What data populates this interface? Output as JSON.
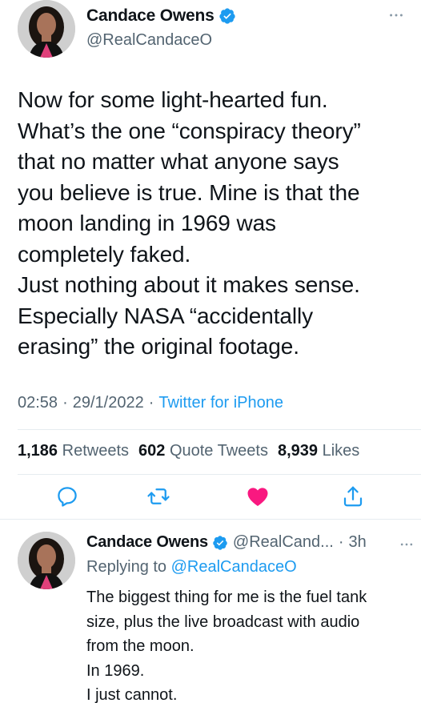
{
  "tweet": {
    "author_name": "Candace Owens",
    "author_handle": "@RealCandaceO",
    "text_lines": [
      "Now for some light-hearted fun.",
      "What’s the one “conspiracy theory”",
      "that no matter what anyone says",
      "you believe is true. Mine is that the",
      "moon landing in 1969 was",
      "completely faked.",
      "Just nothing about it makes sense.",
      "Especially NASA “accidentally",
      "erasing” the original footage."
    ],
    "time": "02:58",
    "date": "29/1/2022",
    "source": "Twitter for iPhone",
    "separator": "·"
  },
  "stats": {
    "retweets_count": "1,186",
    "retweets_label": "Retweets",
    "quotes_count": "602",
    "quotes_label": "Quote Tweets",
    "likes_count": "8,939",
    "likes_label": "Likes"
  },
  "actions": {
    "icons": [
      "reply-icon",
      "retweet-icon",
      "like-icon",
      "share-icon"
    ],
    "like_color": "#f91880",
    "icon_color": "#1d9bf0"
  },
  "reply": {
    "author_name": "Candace Owens",
    "author_handle": "@RealCand...",
    "separator": "·",
    "age": "3h",
    "replying_label": "Replying to",
    "replying_to": "@RealCandaceO",
    "text_lines": [
      "The biggest thing for me is the fuel tank",
      "size, plus the live broadcast with audio",
      "from the moon.",
      "In 1969.",
      "I just cannot."
    ]
  },
  "colors": {
    "verified": "#1d9bf0",
    "link": "#1d9bf0",
    "secondary_text": "#536471"
  }
}
